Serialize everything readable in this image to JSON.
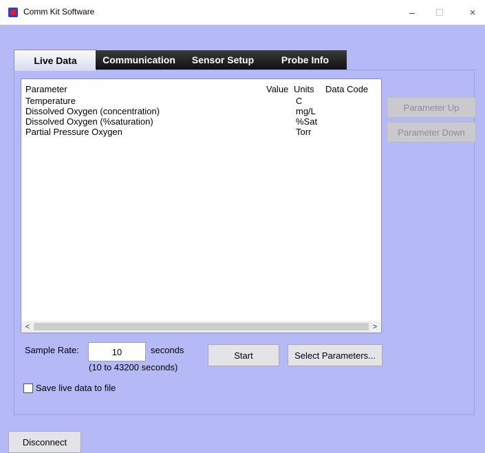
{
  "window": {
    "title": "Comm Kit Software",
    "minimize": "–",
    "close": "×"
  },
  "tabs": [
    {
      "label": "Live Data",
      "active": true
    },
    {
      "label": "Communication",
      "active": false
    },
    {
      "label": "Sensor Setup",
      "active": false
    },
    {
      "label": "Probe Info",
      "active": false
    }
  ],
  "table": {
    "columns": [
      "Parameter",
      "Value",
      "Units",
      "Data Code"
    ],
    "rows": [
      {
        "parameter": "Temperature",
        "value": "",
        "units": "C",
        "data_code": ""
      },
      {
        "parameter": "Dissolved Oxygen (concentration)",
        "value": "",
        "units": "mg/L",
        "data_code": ""
      },
      {
        "parameter": "Dissolved Oxygen (%saturation)",
        "value": "",
        "units": "%Sat",
        "data_code": ""
      },
      {
        "parameter": "Partial Pressure Oxygen",
        "value": "",
        "units": "Torr",
        "data_code": ""
      }
    ],
    "scroll_left": "<",
    "scroll_right": ">"
  },
  "side_buttons": {
    "up": "Parameter Up",
    "down": "Parameter Down"
  },
  "sample_rate": {
    "label": "Sample Rate:",
    "value": "10",
    "unit": "seconds",
    "range_hint": "(10 to 43200 seconds)"
  },
  "buttons": {
    "start": "Start",
    "select_parameters": "Select Parameters...",
    "disconnect": "Disconnect"
  },
  "save_checkbox": {
    "label": "Save live data to file",
    "checked": false
  },
  "colors": {
    "window_bg": "#b5baf7",
    "tab_dark": "#111111",
    "disabled_button_text": "#8e8e96"
  }
}
